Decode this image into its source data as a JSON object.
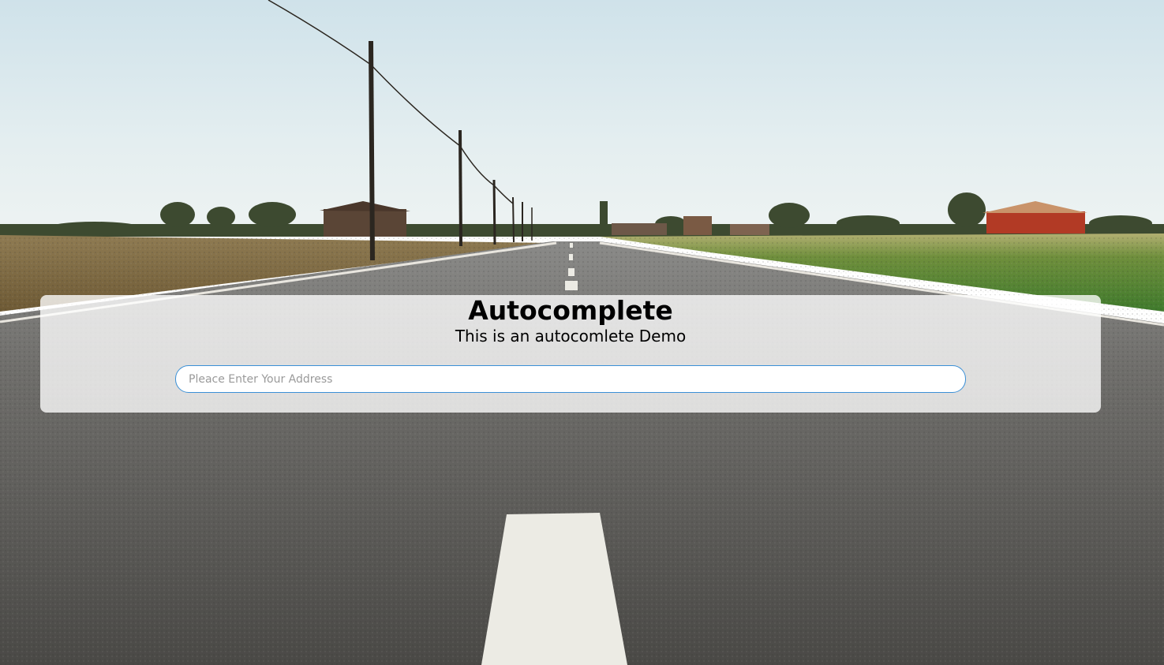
{
  "panel": {
    "title": "Autocomplete",
    "subtitle": "This is an autocomlete Demo"
  },
  "search": {
    "value": "",
    "placeholder": "Pleace Enter Your Address"
  },
  "colors": {
    "input_border": "#3a8fd6",
    "panel_bg": "rgba(255,255,255,0.78)"
  },
  "background": {
    "icon": "road-landscape-photo"
  }
}
